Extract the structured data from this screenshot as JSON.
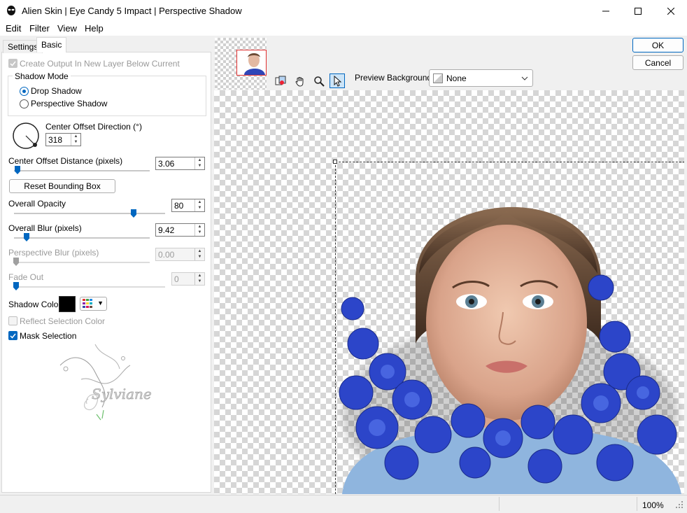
{
  "window": {
    "title": "Alien Skin | Eye Candy 5 Impact | Perspective Shadow"
  },
  "menu": {
    "edit": "Edit",
    "filter": "Filter",
    "view": "View",
    "help": "Help"
  },
  "tabs": {
    "settings": "Settings",
    "basic": "Basic"
  },
  "basic": {
    "create_output_label": "Create Output In New Layer Below Current",
    "create_output_checked": true,
    "shadow_mode_title": "Shadow Mode",
    "shadow_mode_options": [
      "Drop Shadow",
      "Perspective Shadow"
    ],
    "shadow_mode_selected": "Drop Shadow",
    "center_offset_direction_label": "Center Offset Direction (°)",
    "center_offset_direction_value": "318",
    "center_offset_distance_label": "Center Offset Distance (pixels)",
    "center_offset_distance_value": "3.06",
    "reset_bounding_box_label": "Reset Bounding Box",
    "overall_opacity_label": "Overall Opacity",
    "overall_opacity_value": "80",
    "overall_blur_label": "Overall Blur (pixels)",
    "overall_blur_value": "9.42",
    "perspective_blur_label": "Perspective Blur (pixels)",
    "perspective_blur_value": "0.00",
    "fade_out_label": "Fade Out",
    "fade_out_value": "0",
    "shadow_color_label": "Shadow Color",
    "shadow_color": "#000000",
    "reflect_selection_color_label": "Reflect Selection Color",
    "reflect_selection_color_checked": false,
    "mask_selection_label": "Mask Selection",
    "mask_selection_checked": true,
    "watermark_text": "Sylviane"
  },
  "dialog_buttons": {
    "ok": "OK",
    "cancel": "Cancel"
  },
  "preview": {
    "background_label": "Preview Background:",
    "background_value": "None"
  },
  "status": {
    "zoom": "100%"
  },
  "colors": {
    "accent": "#0067c0",
    "thumb_frame": "#e03030"
  }
}
